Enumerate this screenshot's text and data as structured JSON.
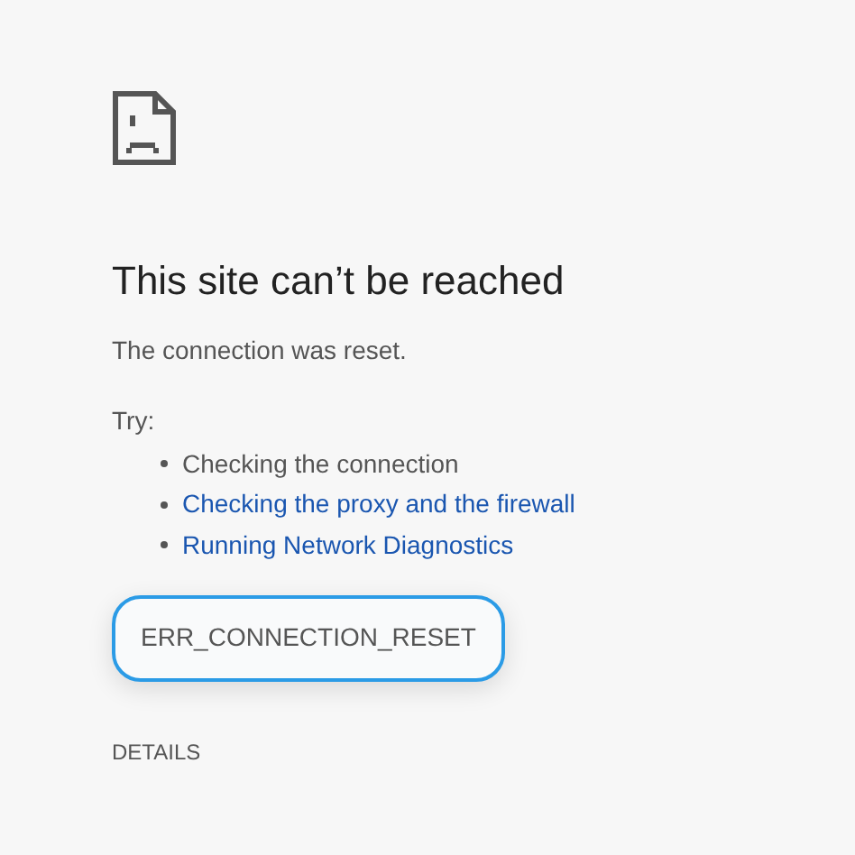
{
  "heading": "This site can’t be reached",
  "message": "The connection was reset.",
  "try_label": "Try:",
  "suggestions": [
    {
      "text": "Checking the connection",
      "kind": "text"
    },
    {
      "text": "Checking the proxy and the firewall",
      "kind": "link"
    },
    {
      "text": "Running Network Diagnostics",
      "kind": "link"
    }
  ],
  "error_code": {
    "text": "ERR_CONNECTION_RESET",
    "focused": true
  },
  "details_button": "DETAILS"
}
